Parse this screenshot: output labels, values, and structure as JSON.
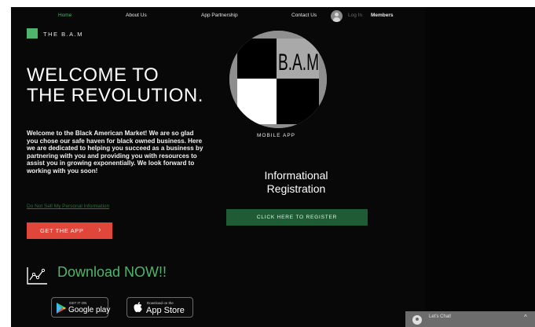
{
  "nav": {
    "items": [
      "Home",
      "About Us",
      "App Partnership",
      "Contact Us"
    ],
    "login": "Log In",
    "members": "Members"
  },
  "brand": {
    "name": "THE B.A.M"
  },
  "hero": {
    "line1": "WELCOME TO",
    "line2": "THE REVOLUTION.",
    "intro": "Welcome to the Black American Market! We are so glad you chose our safe haven for black owned business. Here we are dedicated to helping you succeed as a business by partnering with you and providing you with resources to assist you in growing exponentially. We look forward to working with you soon!",
    "privacy_link": "Do Not Sell My Personal Information",
    "get_app": "GET THE APP",
    "get_app_arrow": "›"
  },
  "download": {
    "title": "Download NOW!!",
    "google": {
      "small": "GET IT ON",
      "big": "Google play"
    },
    "apple": {
      "small": "Download on the",
      "big": "App Store"
    }
  },
  "center": {
    "logo_text": "B.A.M",
    "mobile_app": "MOBILE APP",
    "info_line1": "Informational",
    "info_line2": "Registration",
    "register": "CLICK HERE TO REGISTER"
  },
  "chat": {
    "label": "Let's Chat!",
    "chevron": "^"
  },
  "colors": {
    "accent": "#4fb46c",
    "cta_red": "#e0463a",
    "register_green": "#1f5b34"
  }
}
